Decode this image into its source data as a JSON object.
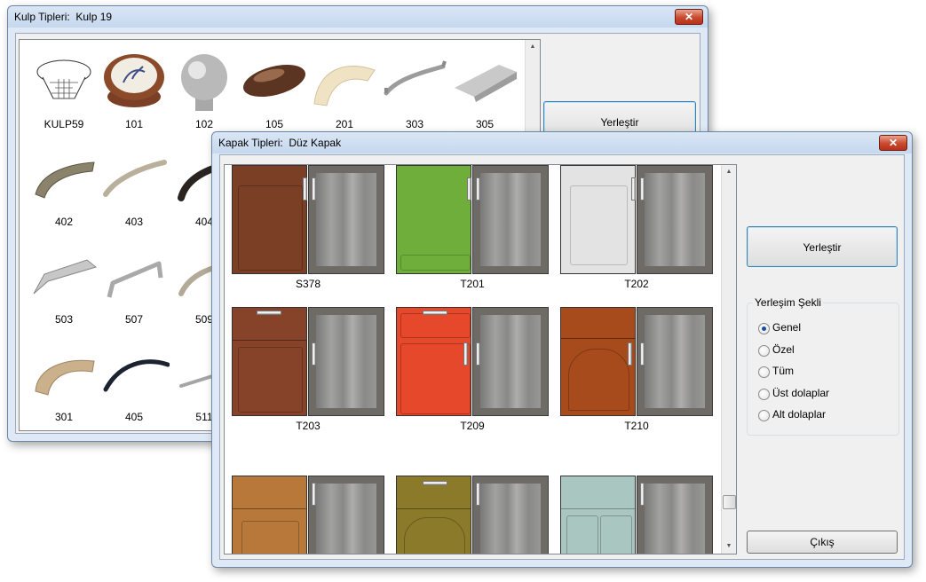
{
  "kulp_window": {
    "title": "Kulp Tipleri:  Kulp 19",
    "close_glyph": "✕",
    "place_button": "Yerleştir",
    "items": [
      {
        "label": "KULP59",
        "icon": "knob-wireframe"
      },
      {
        "label": "101",
        "icon": "knob-porcelain"
      },
      {
        "label": "102",
        "icon": "knob-ball"
      },
      {
        "label": "105",
        "icon": "knob-bronze"
      },
      {
        "label": "201",
        "icon": "handle-cream"
      },
      {
        "label": "303",
        "icon": "handle-bar"
      },
      {
        "label": "305",
        "icon": "handle-profile"
      },
      {
        "label": "402",
        "icon": "handle-antique"
      },
      {
        "label": "403",
        "icon": "handle-bow"
      },
      {
        "label": "404",
        "icon": "handle-black"
      },
      {
        "label": "503",
        "icon": "handle-flat"
      },
      {
        "label": "507",
        "icon": "handle-rail"
      },
      {
        "label": "509",
        "icon": "handle-curved"
      },
      {
        "label": "301",
        "icon": "handle-beige"
      },
      {
        "label": "405",
        "icon": "handle-arc-black"
      },
      {
        "label": "511",
        "icon": "handle-slim"
      }
    ]
  },
  "kapak_window": {
    "title": "Kapak Tipleri:  Düz Kapak",
    "close_glyph": "✕",
    "place_button": "Yerleştir",
    "exit_button": "Çıkış",
    "group_title": "Yerleşim Şekli",
    "options": [
      {
        "label": "Genel",
        "selected": true
      },
      {
        "label": "Özel",
        "selected": false
      },
      {
        "label": "Tüm",
        "selected": false
      },
      {
        "label": "Üst dolaplar",
        "selected": false
      },
      {
        "label": "Alt dolaplar",
        "selected": false
      }
    ],
    "doors": [
      {
        "label": "S378",
        "color": "#7a3f24"
      },
      {
        "label": "T201",
        "color": "#6fae3a"
      },
      {
        "label": "T202",
        "color": "#e3e3e3"
      },
      {
        "label": "T203",
        "color": "#86432a"
      },
      {
        "label": "T209",
        "color": "#e5482a"
      },
      {
        "label": "T210",
        "color": "#a84b1c"
      },
      {
        "label": "",
        "color": "#b8783a"
      },
      {
        "label": "",
        "color": "#8a7a2a"
      },
      {
        "label": "",
        "color": "#a9c7c0"
      }
    ]
  }
}
